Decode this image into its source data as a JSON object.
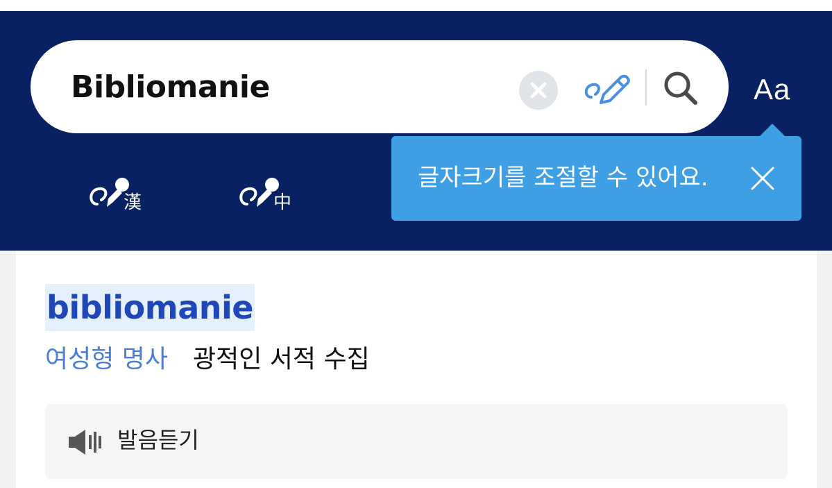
{
  "search": {
    "query": "Bibliomanie"
  },
  "header": {
    "font_size_label": "Aa",
    "hanja_icon_char": "漢",
    "chinese_icon_char": "中"
  },
  "tooltip": {
    "text": "글자크기를 조절할 수 있어요."
  },
  "entry": {
    "headword": "bibliomanie",
    "part_of_speech": "여성형 명사",
    "meaning": "광적인 서적 수집",
    "audio_label": "발음듣기"
  },
  "icons": {
    "clear": "clear-icon",
    "handwriting": "handwriting-pen-icon",
    "search": "search-icon",
    "hanja_handwriting": "hanja-handwriting-icon",
    "chinese_handwriting": "chinese-handwriting-icon",
    "close": "close-icon",
    "speaker": "speaker-icon"
  },
  "colors": {
    "header_bg": "#072162",
    "tooltip_bg": "#3f9fe4",
    "accent_blue": "#4a90e2",
    "headword": "#2047b8",
    "headword_highlight": "#e4f1fc",
    "part_of_speech": "#4b7fd5"
  }
}
